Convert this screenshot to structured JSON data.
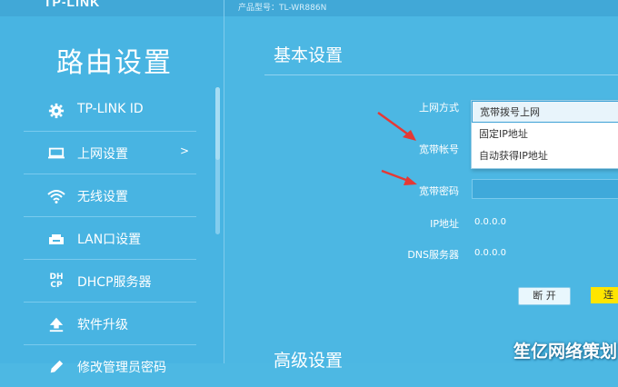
{
  "header": {
    "brand": "TP-LINK",
    "model": "产品型号：TL-WR886N"
  },
  "sidebar": {
    "title": "路由设置",
    "items": [
      {
        "label": "TP-LINK ID",
        "icon": "gear-icon"
      },
      {
        "label": "上网设置",
        "icon": "monitor-icon",
        "arrow": ">"
      },
      {
        "label": "无线设置",
        "icon": "wifi-icon"
      },
      {
        "label": "LAN口设置",
        "icon": "lan-icon"
      },
      {
        "label": "DHCP服务器",
        "icon": "dhcp-icon",
        "icon_text": "DH CP"
      },
      {
        "label": "软件升级",
        "icon": "upload-icon"
      },
      {
        "label": "修改管理员密码",
        "icon": "pencil-icon"
      }
    ]
  },
  "main": {
    "section_basic": "基本设置",
    "section_advanced": "高级设置",
    "fields": {
      "wan_mode_label": "上网方式",
      "account_label": "宽带帐号",
      "password_label": "宽带密码",
      "ip_label": "IP地址",
      "ip_value": "0.0.0.0",
      "dns_label": "DNS服务器",
      "dns_value": "0.0.0.0"
    },
    "dropdown": {
      "options": [
        "宽带拨号上网",
        "固定IP地址",
        "自动获得IP地址"
      ]
    },
    "buttons": {
      "disconnect": "断 开",
      "connect": "连"
    }
  },
  "watermark": "笙亿网络策划",
  "colors": {
    "background": "#4db8e3",
    "sidebar": "#48b4e2",
    "accent_yellow": "#ffe500",
    "annotation_red": "#e53935"
  }
}
